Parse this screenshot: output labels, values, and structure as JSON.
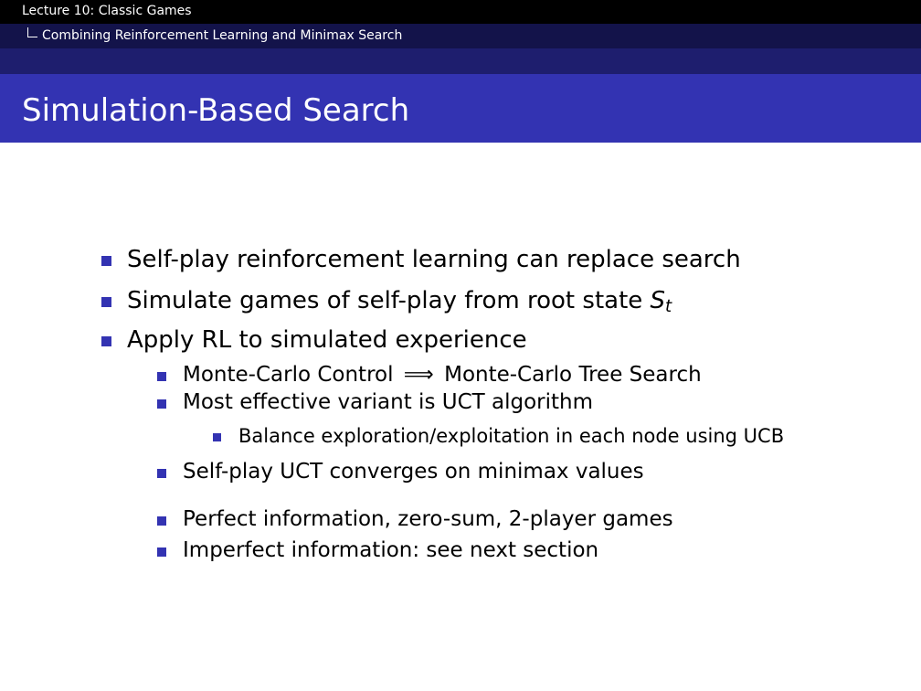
{
  "header": {
    "lecture": "Lecture 10: Classic Games",
    "section": "Combining Reinforcement Learning and Minimax Search"
  },
  "slide": {
    "title": "Simulation-Based Search",
    "bullets": [
      "Self-play reinforcement learning can replace search",
      "Simulate games of self-play from root state",
      "Apply RL to simulated experience"
    ],
    "root_state_symbol": "S",
    "root_state_subscript": "t",
    "sub_bullets": {
      "mc_control": "Monte-Carlo Control",
      "implies": "⟹",
      "mcts": "Monte-Carlo Tree Search",
      "uct_variant": "Most effective variant is UCT algorithm",
      "ucb_balance": "Balance exploration/exploitation in each node using UCB",
      "uct_converges": "Self-play UCT converges on minimax values",
      "perfect_info": "Perfect information, zero-sum, 2-player games",
      "imperfect_info": "Imperfect information: see next section"
    }
  },
  "colors": {
    "accent": "#3333b2",
    "header_black": "#000000",
    "header_navy": "#13134a"
  }
}
